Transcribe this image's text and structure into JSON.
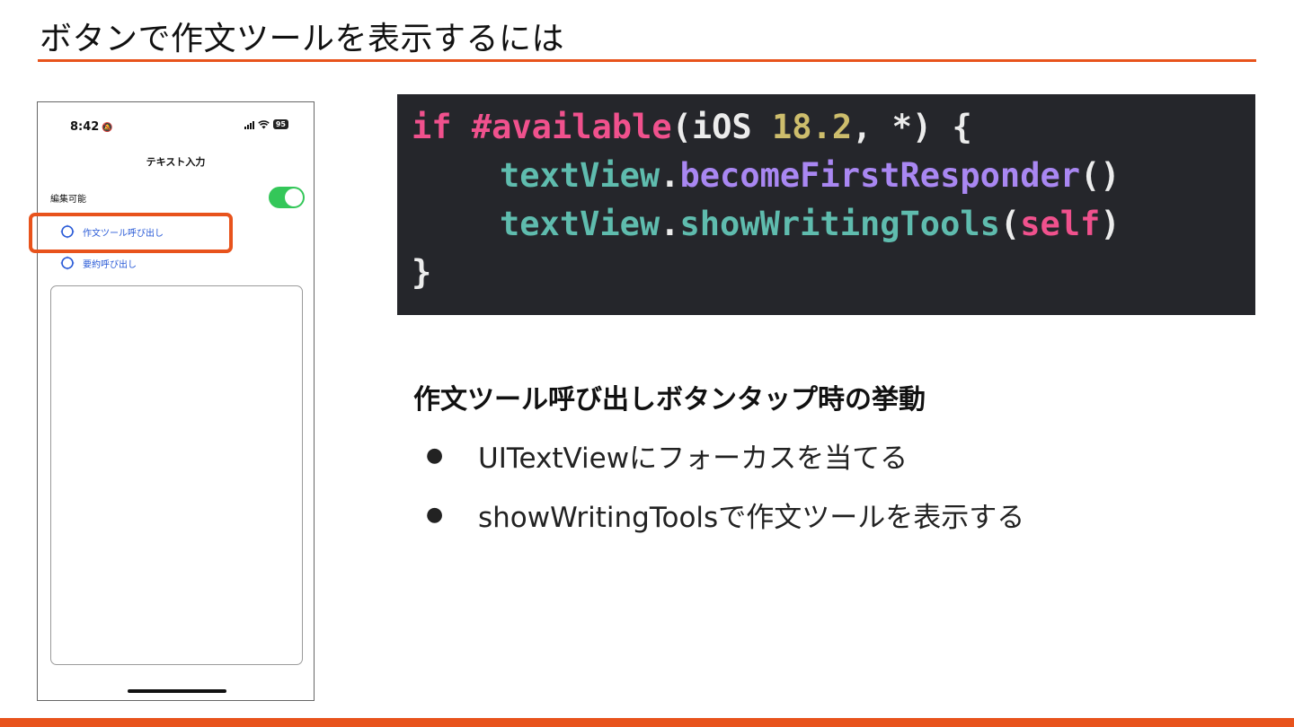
{
  "slide": {
    "title": "ボタンで作文ツールを表示するには",
    "accent_color": "#e8531c"
  },
  "phone": {
    "status_time": "8:42",
    "battery": "95",
    "nav_title": "テキスト入力",
    "edit_label": "編集可能",
    "toggle_on": true,
    "menu_items": [
      {
        "label": "作文ツール呼び出し",
        "icon": "sparkle-icon"
      },
      {
        "label": "要約呼び出し",
        "icon": "sparkle-icon"
      }
    ],
    "highlighted_item": "作文ツール呼び出し"
  },
  "code": {
    "lines": [
      [
        {
          "t": "if",
          "c": "kw"
        },
        {
          "t": " ",
          "c": "plain"
        },
        {
          "t": "#available",
          "c": "kw"
        },
        {
          "t": "(iOS ",
          "c": "plain"
        },
        {
          "t": "18.2",
          "c": "num"
        },
        {
          "t": ", *) {",
          "c": "plain"
        }
      ],
      [
        {
          "t": "textView",
          "c": "prop"
        },
        {
          "t": ".",
          "c": "plain"
        },
        {
          "t": "becomeFirstResponder",
          "c": "meth"
        },
        {
          "t": "()",
          "c": "plain"
        }
      ],
      [
        {
          "t": "textView",
          "c": "prop"
        },
        {
          "t": ".",
          "c": "plain"
        },
        {
          "t": "showWritingTools",
          "c": "prop"
        },
        {
          "t": "(",
          "c": "plain"
        },
        {
          "t": "self",
          "c": "kw"
        },
        {
          "t": ")",
          "c": "plain"
        }
      ],
      [
        {
          "t": "}",
          "c": "plain"
        }
      ]
    ]
  },
  "content": {
    "heading": "作文ツール呼び出しボタンタップ時の挙動",
    "bullets": [
      "UITextViewにフォーカスを当てる",
      "showWritingToolsで作文ツールを表示する"
    ]
  }
}
